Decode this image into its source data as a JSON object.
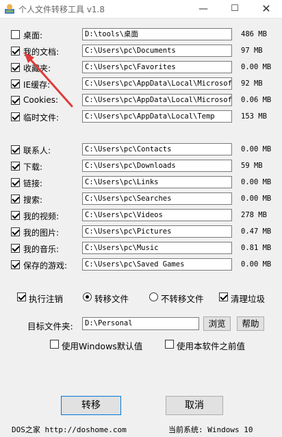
{
  "window": {
    "title": "个人文件转移工具 v1.8",
    "min_symbol": "—",
    "max_symbol": "☐",
    "close_symbol": "✕"
  },
  "folders": [
    {
      "label": "桌面:",
      "path": "D:\\tools\\桌面",
      "size": "486 MB",
      "checked": false
    },
    {
      "label": "我的文档:",
      "path": "C:\\Users\\pc\\Documents",
      "size": "97 MB",
      "checked": true
    },
    {
      "label": "收藏夹:",
      "path": "C:\\Users\\pc\\Favorites",
      "size": "0.00 MB",
      "checked": true
    },
    {
      "label": "IE缓存:",
      "path": "C:\\Users\\pc\\AppData\\Local\\Microsoft\\",
      "size": "92 MB",
      "checked": true
    },
    {
      "label": "Cookies:",
      "path": "C:\\Users\\pc\\AppData\\Local\\Microsoft\\",
      "size": "0.06 MB",
      "checked": true
    },
    {
      "label": "临时文件:",
      "path": "C:\\Users\\pc\\AppData\\Local\\Temp",
      "size": "153 MB",
      "checked": true
    },
    {
      "label": "联系人:",
      "path": "C:\\Users\\pc\\Contacts",
      "size": "0.00 MB",
      "checked": true
    },
    {
      "label": "下载:",
      "path": "C:\\Users\\pc\\Downloads",
      "size": "59 MB",
      "checked": true
    },
    {
      "label": "链接:",
      "path": "C:\\Users\\pc\\Links",
      "size": "0.00 MB",
      "checked": true
    },
    {
      "label": "搜索:",
      "path": "C:\\Users\\pc\\Searches",
      "size": "0.00 MB",
      "checked": true
    },
    {
      "label": "我的视频:",
      "path": "C:\\Users\\pc\\Videos",
      "size": "278 MB",
      "checked": true
    },
    {
      "label": "我的图片:",
      "path": "C:\\Users\\pc\\Pictures",
      "size": "0.47 MB",
      "checked": true
    },
    {
      "label": "我的音乐:",
      "path": "C:\\Users\\pc\\Music",
      "size": "0.81 MB",
      "checked": true
    },
    {
      "label": "保存的游戏:",
      "path": "C:\\Users\\pc\\Saved Games",
      "size": "0.00 MB",
      "checked": true
    }
  ],
  "options": {
    "execute_logoff": {
      "label": "执行注销",
      "checked": true
    },
    "mode_transfer": {
      "label": "转移文件",
      "selected": true
    },
    "mode_no_transfer": {
      "label": "不转移文件",
      "selected": false
    },
    "clean_junk": {
      "label": "清理垃圾",
      "checked": true
    }
  },
  "target": {
    "label": "目标文件夹:",
    "value": "D:\\Personal",
    "browse_label": "浏览",
    "help_label": "帮助"
  },
  "defaults": {
    "windows_default": {
      "label": "使用Windows默认值",
      "checked": false
    },
    "previous_value": {
      "label": "使用本软件之前值",
      "checked": false
    }
  },
  "actions": {
    "transfer_label": "转移",
    "cancel_label": "取消"
  },
  "footer": {
    "left": "DOS之家 http://doshome.com",
    "right": "当前系统: Windows 10"
  },
  "colors": {
    "arrow": "#e03a3a",
    "focus_border": "#0078d7"
  }
}
